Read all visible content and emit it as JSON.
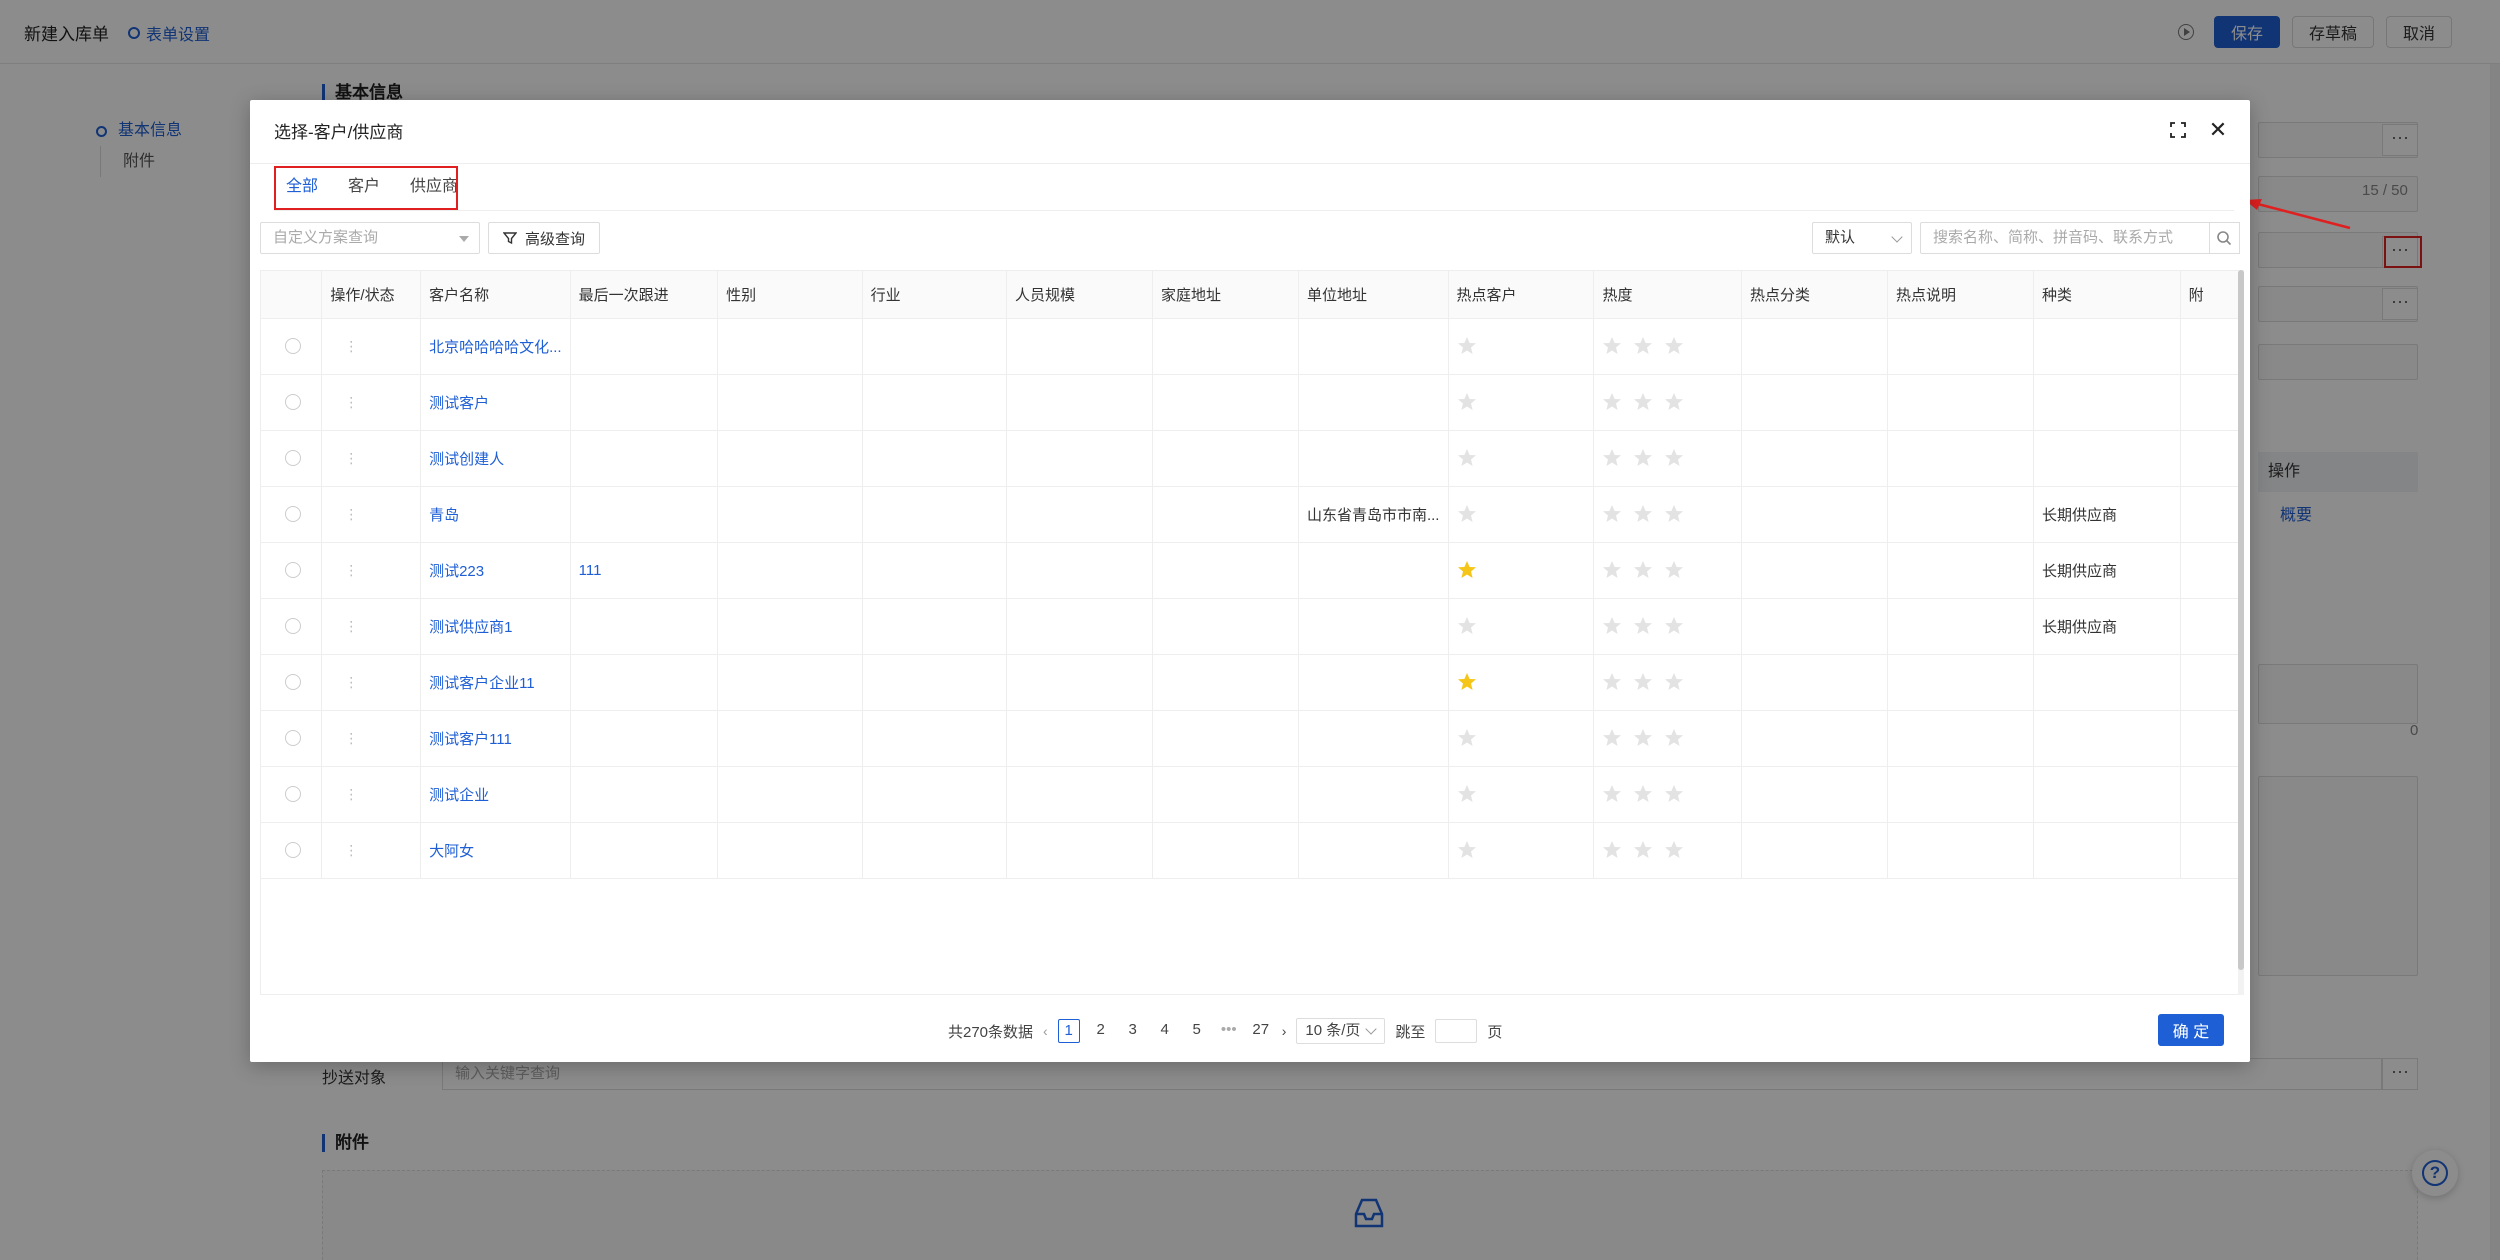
{
  "background": {
    "page_title": "新建入库单",
    "form_settings": "表单设置",
    "buttons": {
      "save": "保存",
      "draft": "存草稿",
      "cancel": "取消"
    },
    "side_nav": [
      "基本信息",
      "附件"
    ],
    "section_basic": "基本信息",
    "section_attach": "附件",
    "counter": "15 / 50",
    "ops_header": "操作",
    "ops_link": "概要",
    "zero": "0",
    "cc_label": "抄送对象",
    "cc_placeholder": "输入关键字查询",
    "help": "?"
  },
  "modal": {
    "title": "选择-客户/供应商",
    "tabs": [
      "全部",
      "客户",
      "供应商"
    ],
    "scheme_placeholder": "自定义方案查询",
    "advanced_search": "高级查询",
    "sort_value": "默认",
    "search_placeholder": "搜索名称、简称、拼音码、联系方式",
    "columns": [
      "",
      "操作/状态",
      "客户名称",
      "最后一次跟进",
      "性别",
      "行业",
      "人员规模",
      "家庭地址",
      "单位地址",
      "热点客户",
      "热度",
      "热点分类",
      "热点说明",
      "种类",
      "附"
    ],
    "rows": [
      {
        "name": "北京哈哈哈哈文化...",
        "follow": "",
        "addr": "",
        "hot": false,
        "kind": ""
      },
      {
        "name": "测试客户",
        "follow": "",
        "addr": "",
        "hot": false,
        "kind": ""
      },
      {
        "name": "测试创建人",
        "follow": "",
        "addr": "",
        "hot": false,
        "kind": ""
      },
      {
        "name": "青岛",
        "follow": "",
        "addr": "山东省青岛市市南...",
        "hot": false,
        "kind": "长期供应商"
      },
      {
        "name": "测试223",
        "follow": "111",
        "addr": "",
        "hot": true,
        "kind": "长期供应商"
      },
      {
        "name": "测试供应商1",
        "follow": "",
        "addr": "",
        "hot": false,
        "kind": "长期供应商"
      },
      {
        "name": "测试客户企业11",
        "follow": "",
        "addr": "",
        "hot": true,
        "kind": ""
      },
      {
        "name": "测试客户111",
        "follow": "",
        "addr": "",
        "hot": false,
        "kind": ""
      },
      {
        "name": "测试企业",
        "follow": "",
        "addr": "",
        "hot": false,
        "kind": ""
      },
      {
        "name": "大阿女",
        "follow": "",
        "addr": "",
        "hot": false,
        "kind": ""
      }
    ],
    "pagination": {
      "total": "共270条数据",
      "pages": [
        "1",
        "2",
        "3",
        "4",
        "5",
        "•••",
        "27"
      ],
      "active": "1",
      "page_size": "10 条/页",
      "jump_label": "跳至",
      "page_suffix": "页"
    },
    "confirm": "确 定"
  },
  "colors": {
    "accent": "#1f5fd6",
    "annotation": "#e02020",
    "star_on": "#f5c518",
    "star_off": "#e3e3e3"
  }
}
